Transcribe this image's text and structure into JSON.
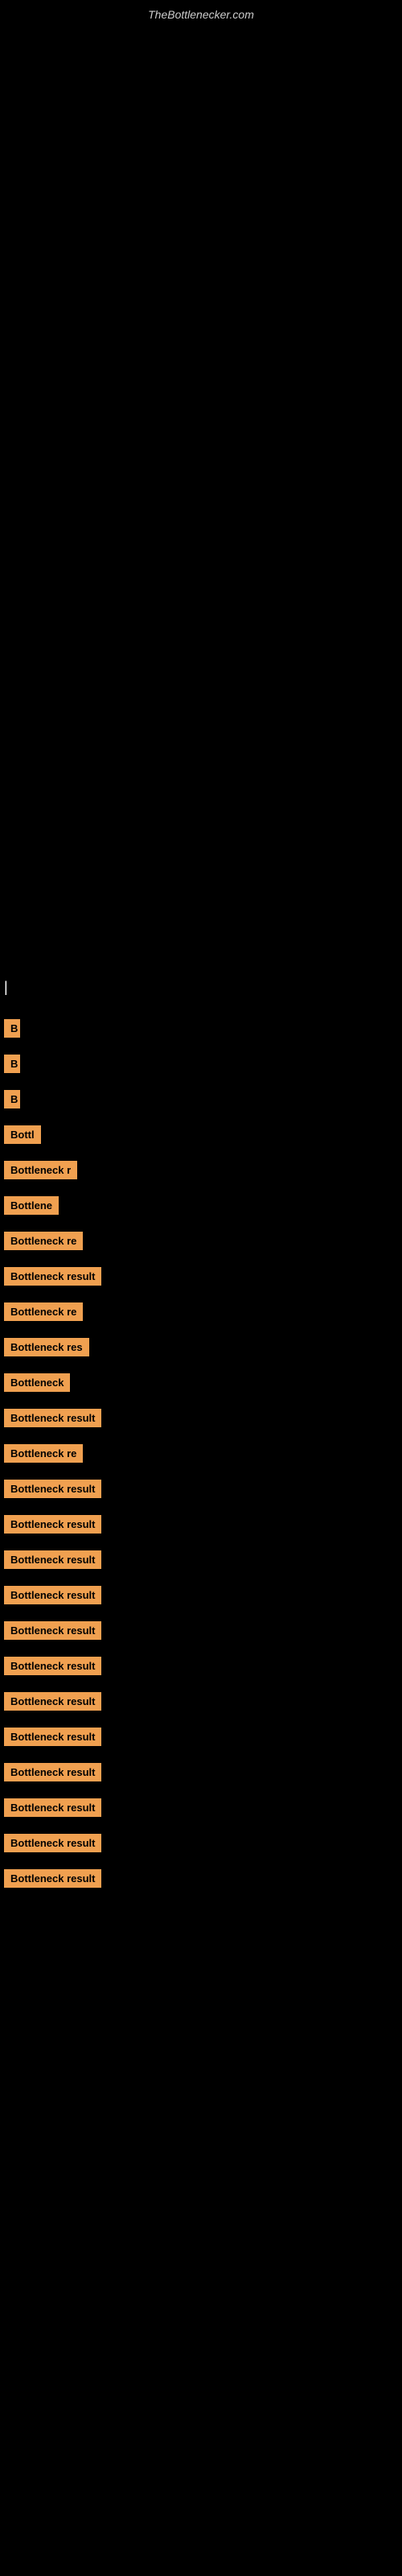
{
  "site": {
    "title": "TheBottlenecker.com"
  },
  "cursor": {
    "symbol": "|"
  },
  "results": [
    {
      "id": 1,
      "label": "B",
      "width_class": "w-20"
    },
    {
      "id": 2,
      "label": "B",
      "width_class": "w-20"
    },
    {
      "id": 3,
      "label": "B",
      "width_class": "w-20"
    },
    {
      "id": 4,
      "label": "Bottl",
      "width_class": "w-50"
    },
    {
      "id": 5,
      "label": "Bottleneck r",
      "width_class": "w-110"
    },
    {
      "id": 6,
      "label": "Bottlene",
      "width_class": "w-80"
    },
    {
      "id": 7,
      "label": "Bottleneck re",
      "width_class": "w-130"
    },
    {
      "id": 8,
      "label": "Bottleneck resul",
      "width_class": "w-150"
    },
    {
      "id": 9,
      "label": "Bottleneck re",
      "width_class": "w-130"
    },
    {
      "id": 10,
      "label": "Bottleneck res",
      "width_class": "w-140"
    },
    {
      "id": 11,
      "label": "Bottleneck",
      "width_class": "w-100"
    },
    {
      "id": 12,
      "label": "Bottleneck result",
      "width_class": "w-160"
    },
    {
      "id": 13,
      "label": "Bottleneck re",
      "width_class": "w-130"
    },
    {
      "id": 14,
      "label": "Bottleneck result",
      "width_class": "w-170"
    },
    {
      "id": 15,
      "label": "Bottleneck result",
      "width_class": "w-180"
    },
    {
      "id": 16,
      "label": "Bottleneck result",
      "width_class": "w-180"
    },
    {
      "id": 17,
      "label": "Bottleneck result",
      "width_class": "w-180"
    },
    {
      "id": 18,
      "label": "Bottleneck result",
      "width_class": "w-200"
    },
    {
      "id": 19,
      "label": "Bottleneck result",
      "width_class": "w-200"
    },
    {
      "id": 20,
      "label": "Bottleneck result",
      "width_class": "w-200"
    },
    {
      "id": 21,
      "label": "Bottleneck result",
      "width_class": "w-200"
    },
    {
      "id": 22,
      "label": "Bottleneck result",
      "width_class": "w-210"
    },
    {
      "id": 23,
      "label": "Bottleneck result",
      "width_class": "w-210"
    },
    {
      "id": 24,
      "label": "Bottleneck result",
      "width_class": "w-210"
    },
    {
      "id": 25,
      "label": "Bottleneck result",
      "width_class": "w-210"
    }
  ]
}
